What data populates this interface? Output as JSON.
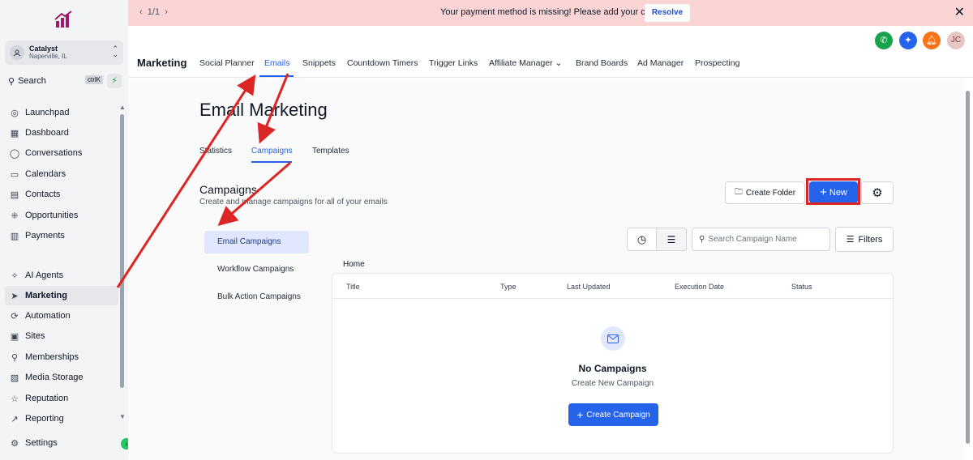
{
  "banner": {
    "pager": "1/1",
    "message": "Your payment method is missing! Please add your card.",
    "resolve_label": "Resolve"
  },
  "account": {
    "name": "Catalyst",
    "location": "Naperville, IL"
  },
  "search": {
    "label": "Search",
    "shortcut": "ctrlK"
  },
  "sidebar": {
    "items": [
      {
        "label": "Launchpad",
        "icon": "rocket-icon"
      },
      {
        "label": "Dashboard",
        "icon": "grid-icon"
      },
      {
        "label": "Conversations",
        "icon": "chat-icon"
      },
      {
        "label": "Calendars",
        "icon": "calendar-icon"
      },
      {
        "label": "Contacts",
        "icon": "contacts-icon"
      },
      {
        "label": "Opportunities",
        "icon": "network-icon"
      },
      {
        "label": "Payments",
        "icon": "receipt-icon"
      },
      {
        "label": "AI Agents",
        "icon": "sparkle-icon"
      },
      {
        "label": "Marketing",
        "icon": "send-icon"
      },
      {
        "label": "Automation",
        "icon": "automation-icon"
      },
      {
        "label": "Sites",
        "icon": "sites-icon"
      },
      {
        "label": "Memberships",
        "icon": "badge-icon"
      },
      {
        "label": "Media Storage",
        "icon": "image-icon"
      },
      {
        "label": "Reputation",
        "icon": "star-icon"
      },
      {
        "label": "Reporting",
        "icon": "trend-icon"
      },
      {
        "label": "Settings",
        "icon": "gear-icon"
      }
    ]
  },
  "header": {
    "section": "Marketing",
    "avatar": "JC",
    "tabs": [
      "Social Planner",
      "Emails",
      "Snippets",
      "Countdown Timers",
      "Trigger Links",
      "Affiliate Manager",
      "Brand Boards",
      "Ad Manager",
      "Prospecting"
    ]
  },
  "main": {
    "title": "Email Marketing",
    "subtabs": [
      "Statistics",
      "Campaigns",
      "Templates"
    ],
    "section_title": "Campaigns",
    "section_desc": "Create and manage campaigns for all of your emails",
    "create_folder": "Create Folder",
    "new_label": "New",
    "filters_label": "Filters",
    "search_placeholder": "Search Campaign Name",
    "campaign_types": [
      "Email Campaigns",
      "Workflow Campaigns",
      "Bulk Action Campaigns"
    ],
    "breadcrumb": "Home",
    "columns": [
      "Title",
      "Type",
      "Last Updated",
      "Execution Date",
      "Status"
    ],
    "empty_title": "No Campaigns",
    "empty_subtitle": "Create New Campaign",
    "create_button": "Create Campaign"
  },
  "colors": {
    "accent": "#2563eb",
    "banner": "#fbd5d5",
    "highlight": "#dc2626"
  }
}
